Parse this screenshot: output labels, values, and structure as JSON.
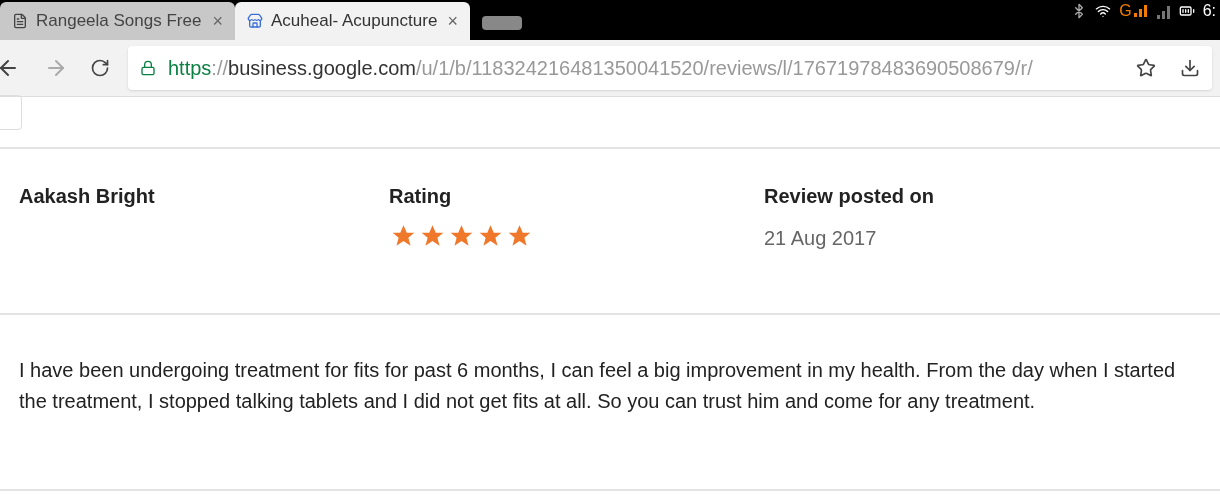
{
  "status_bar": {
    "network": "G",
    "time": "6:"
  },
  "tabs": [
    {
      "title": "Rangeela Songs Free",
      "close": "×",
      "selected": false
    },
    {
      "title": "Acuheal- Acupuncture",
      "close": "×",
      "selected": true
    }
  ],
  "address_bar": {
    "scheme": "https",
    "separator": "://",
    "host": "business.google.com",
    "path": "/u/1/b/118324216481350041520/reviews/l/17671978483690508679/r/"
  },
  "review": {
    "reviewer": "Aakash Bright",
    "rating_label": "Rating",
    "stars": 5,
    "date_label": "Review posted on",
    "date": "21 Aug 2017",
    "text": "I have been undergoing treatment for fits for past 6 months, I can feel a big improvement in my health. From the day when I started the treatment, I stopped talking tablets and I did not get fits at all. So you can trust him and come for any treatment."
  }
}
